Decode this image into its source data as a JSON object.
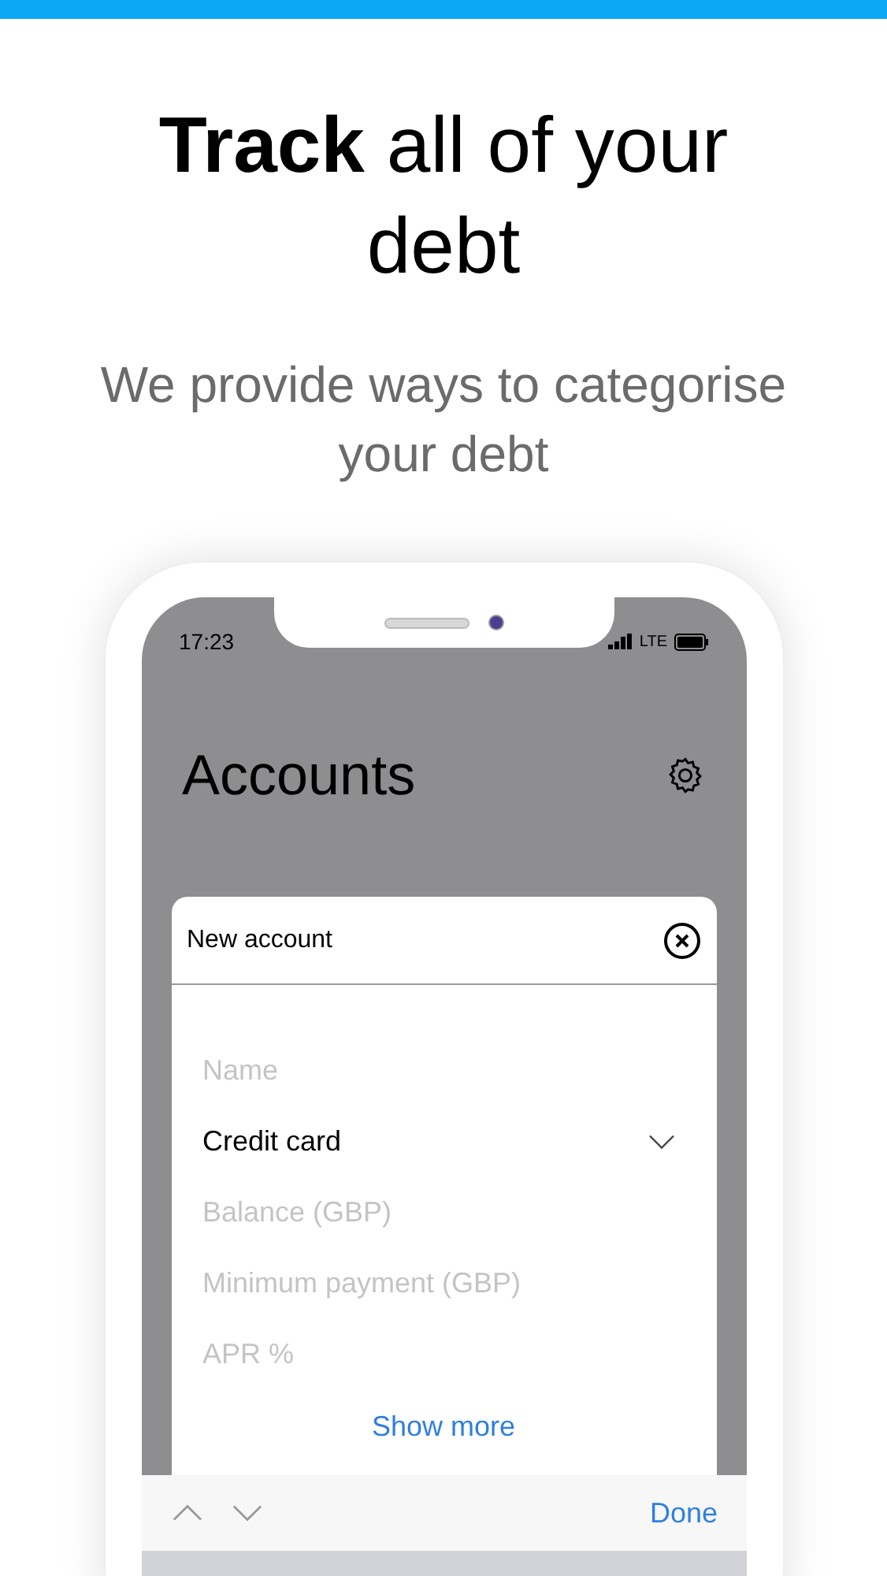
{
  "headline": "**Track** all of your debt",
  "subtitle": "We provide ways to categorise your debt",
  "phone": {
    "status_bar": {
      "time": "17:23",
      "network": "LTE"
    },
    "title": "Accounts",
    "dialog": {
      "title": "New account",
      "fields": [
        {
          "kind": "input",
          "placeholder": "Name"
        },
        {
          "kind": "select",
          "value": "Credit card"
        },
        {
          "kind": "input",
          "placeholder": "Balance (GBP)"
        },
        {
          "kind": "input",
          "placeholder": "Minimum payment (GBP)"
        },
        {
          "kind": "input",
          "placeholder": "APR %"
        }
      ],
      "link": "Show more"
    },
    "keyboard_toolbar": {
      "done": "Done"
    }
  }
}
